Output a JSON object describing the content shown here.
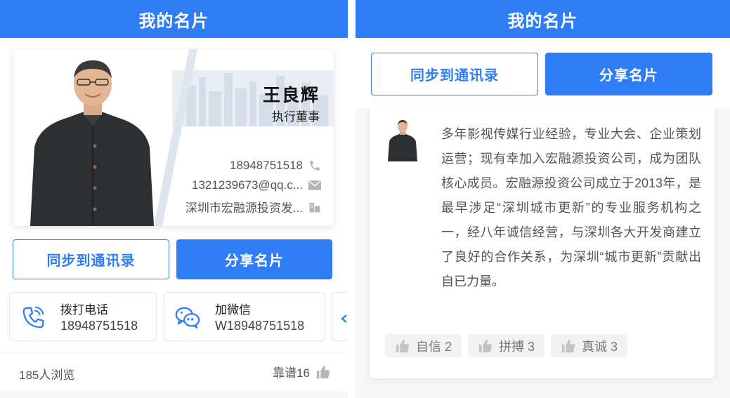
{
  "left": {
    "header_title": "我的名片",
    "card": {
      "name": "王良辉",
      "title": "执行董事",
      "phone": "18948751518",
      "email": "1321239673@qq.c...",
      "address": "深圳市宏融源投资发..."
    },
    "buttons": {
      "sync": "同步到通讯录",
      "share": "分享名片"
    },
    "contacts": [
      {
        "label": "拨打电话",
        "value": "18948751518",
        "icon": "phone-icon"
      },
      {
        "label": "加微信",
        "value": "W18948751518",
        "icon": "wechat-icon"
      }
    ],
    "stats": {
      "views": "185人浏览",
      "likes": "靠谱16"
    }
  },
  "right": {
    "header_title": "我的名片",
    "buttons": {
      "sync": "同步到通讯录",
      "share": "分享名片"
    },
    "intro": "多年影视传媒行业经验，专业大会、企业策划运营；现有幸加入宏融源投资公司，成为团队核心成员。宏融源投资公司成立于2013年，是最早涉足“深圳城市更新”的专业服务机构之一，经八年诚信经营，与深圳各大开发商建立了良好的合作关系，为深圳“城市更新”贡献出自已力量。",
    "tags": [
      {
        "label": "自信 2"
      },
      {
        "label": "拼搏 3"
      },
      {
        "label": "真诚 3"
      }
    ]
  },
  "colors": {
    "brand": "#2f7df6",
    "icon_gray": "#b5b5b5"
  }
}
